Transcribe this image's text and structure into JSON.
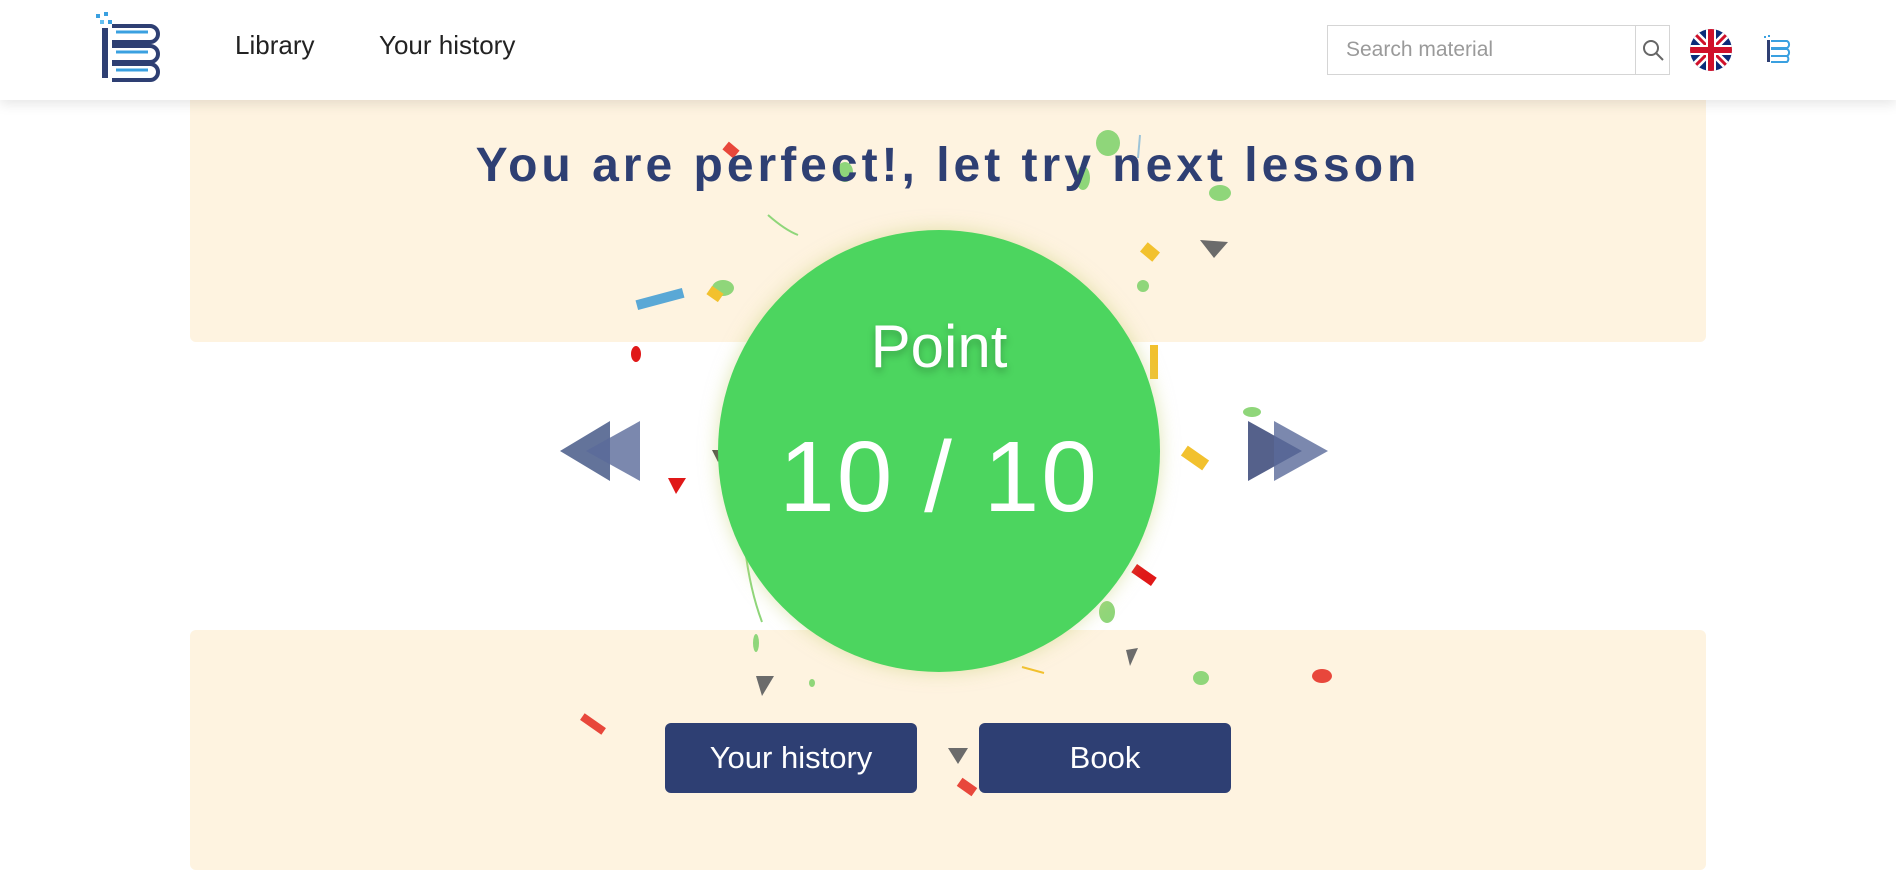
{
  "header": {
    "nav": {
      "library": "Library",
      "history": "Your history"
    },
    "search": {
      "placeholder": "Search material"
    },
    "icons": {
      "logo": "book-logo-icon",
      "search": "search-icon",
      "language": "uk-flag-icon",
      "user": "user-logo-icon"
    }
  },
  "result": {
    "headline": "You are perfect!, let try next lesson",
    "point_label": "Point",
    "score_text": "10 / 10",
    "score": 10,
    "max_score": 10
  },
  "navigation": {
    "prev_icon": "previous-lesson-icon",
    "next_icon": "next-lesson-icon"
  },
  "actions": {
    "history_label": "Your history",
    "book_label": "Book"
  },
  "colors": {
    "primary": "#2e3f73",
    "panel_background": "#fef3e0",
    "score_circle": "#4cd55f",
    "arrow": "#5a6a9a"
  }
}
